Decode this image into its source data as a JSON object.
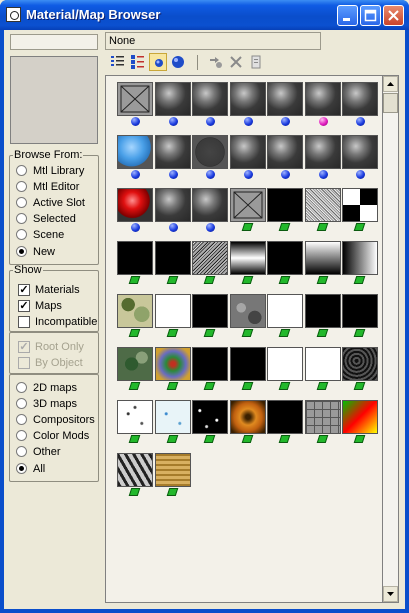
{
  "window": {
    "title": "Material/Map Browser"
  },
  "current_path": "None",
  "name_field": "",
  "browse_from": {
    "legend": "Browse From:",
    "options": [
      "Mtl Library",
      "Mtl Editor",
      "Active Slot",
      "Selected",
      "Scene",
      "New"
    ],
    "selected": "New"
  },
  "show": {
    "legend": "Show",
    "materials": {
      "label": "Materials",
      "checked": true
    },
    "maps": {
      "label": "Maps",
      "checked": true
    },
    "incompatible": {
      "label": "Incompatible",
      "checked": false
    }
  },
  "display_options": {
    "root_only": {
      "label": "Root Only",
      "checked": true,
      "disabled": true
    },
    "by_object": {
      "label": "By Object",
      "checked": false,
      "disabled": true
    }
  },
  "map_filter": {
    "options": [
      "2D maps",
      "3D maps",
      "Compositors",
      "Color Mods",
      "Other",
      "All"
    ],
    "selected": "All"
  },
  "toolbar": {
    "buttons": [
      "view-list-icon",
      "view-list-icons-icon",
      "view-small-icons-icon",
      "view-large-icons-icon",
      "update-scene-materials-icon",
      "delete-icon",
      "clear-material-library-icon"
    ],
    "active": "view-small-icons-icon"
  },
  "swatches": [
    {
      "look": "x-box",
      "kind": "material"
    },
    {
      "look": "sphere",
      "kind": "material"
    },
    {
      "look": "sphere",
      "kind": "material"
    },
    {
      "look": "sphere",
      "kind": "material"
    },
    {
      "look": "sphere",
      "kind": "material"
    },
    {
      "look": "sphere",
      "kind": "material-pink"
    },
    {
      "look": "sphere",
      "kind": "material"
    },
    {
      "look": "blue",
      "kind": "material"
    },
    {
      "look": "sphere",
      "kind": "material"
    },
    {
      "look": "sphere-grey",
      "kind": "material"
    },
    {
      "look": "sphere",
      "kind": "material"
    },
    {
      "look": "sphere",
      "kind": "material"
    },
    {
      "look": "sphere",
      "kind": "material"
    },
    {
      "look": "sphere",
      "kind": "material"
    },
    {
      "look": "red",
      "kind": "material"
    },
    {
      "look": "sphere",
      "kind": "material"
    },
    {
      "look": "sphere",
      "kind": "material"
    },
    {
      "look": "x-box",
      "kind": "map"
    },
    {
      "look": "black",
      "kind": "map"
    },
    {
      "look": "noise",
      "kind": "map"
    },
    {
      "look": "checker",
      "kind": "map"
    },
    {
      "look": "black",
      "kind": "map"
    },
    {
      "look": "black",
      "kind": "map"
    },
    {
      "look": "noise2",
      "kind": "map"
    },
    {
      "look": "grad-h",
      "kind": "map"
    },
    {
      "look": "black",
      "kind": "map"
    },
    {
      "look": "grad-v",
      "kind": "map"
    },
    {
      "look": "grad-r",
      "kind": "map"
    },
    {
      "look": "camo",
      "kind": "map"
    },
    {
      "look": "white",
      "kind": "map"
    },
    {
      "look": "black",
      "kind": "map"
    },
    {
      "look": "marble",
      "kind": "map"
    },
    {
      "look": "white",
      "kind": "map"
    },
    {
      "look": "black",
      "kind": "map"
    },
    {
      "look": "black",
      "kind": "map"
    },
    {
      "look": "green-tex",
      "kind": "map"
    },
    {
      "look": "rainbow",
      "kind": "map"
    },
    {
      "look": "black",
      "kind": "map"
    },
    {
      "look": "black",
      "kind": "map"
    },
    {
      "look": "white",
      "kind": "map"
    },
    {
      "look": "white",
      "kind": "map"
    },
    {
      "look": "stone-dark",
      "kind": "map"
    },
    {
      "look": "speckle-w",
      "kind": "map"
    },
    {
      "look": "speckle-b",
      "kind": "map"
    },
    {
      "look": "sparkle",
      "kind": "map"
    },
    {
      "look": "swirl",
      "kind": "map"
    },
    {
      "look": "black",
      "kind": "map"
    },
    {
      "look": "tiles",
      "kind": "map"
    },
    {
      "look": "rgb",
      "kind": "map"
    },
    {
      "look": "waves",
      "kind": "map"
    },
    {
      "look": "wood",
      "kind": "map"
    }
  ]
}
